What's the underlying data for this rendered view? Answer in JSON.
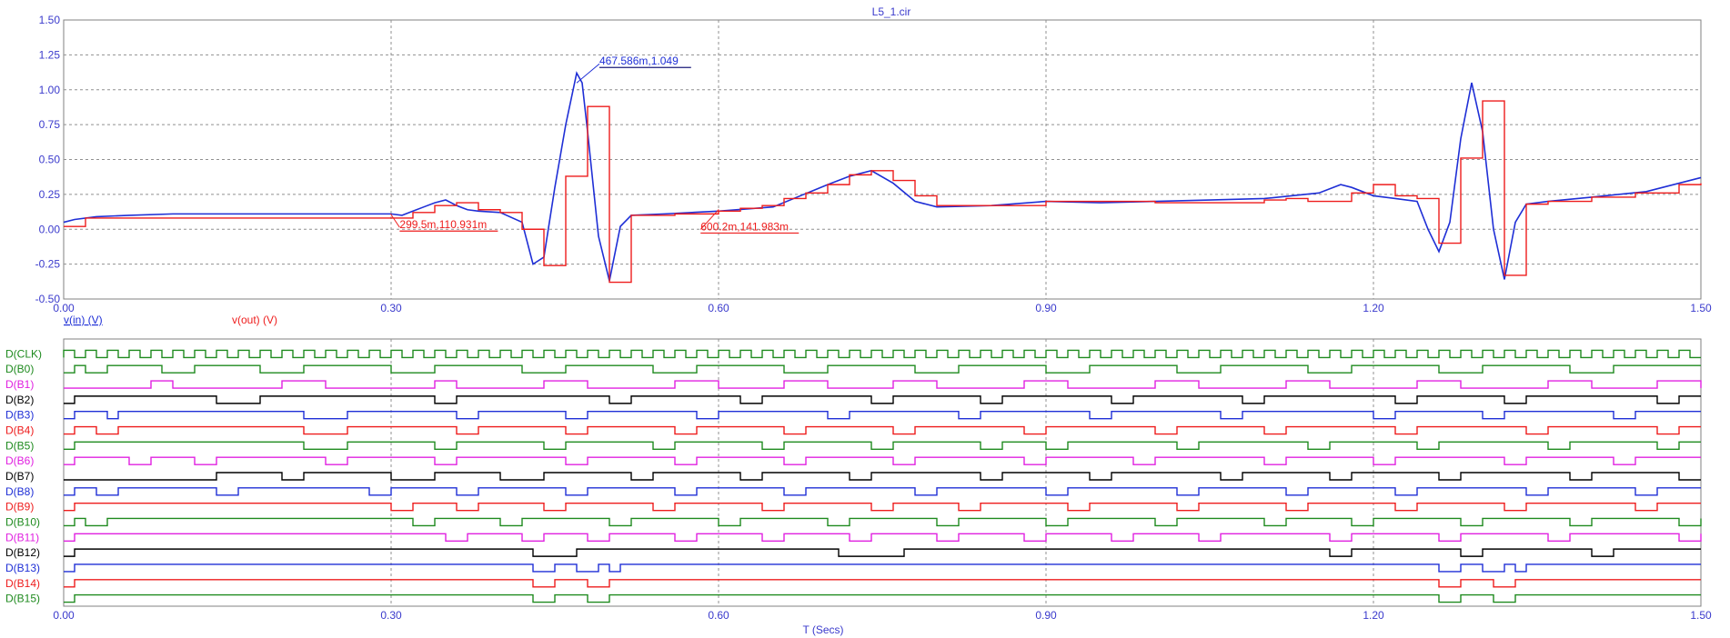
{
  "window_title": "L5_1.cir",
  "colors": {
    "background": "#ffffff",
    "frame": "#808080",
    "grid": "#909090",
    "tick_text": "#3a3acc",
    "vin": "#1f2fd6",
    "vout": "#ee1c1c",
    "green": "#1e8a1e",
    "magenta": "#e020e0",
    "black": "#000000",
    "blue": "#1f2fd6",
    "red": "#ee1c1c"
  },
  "chart_data": [
    {
      "type": "line",
      "title": "L5_1.cir",
      "x_range": [
        0,
        1.5
      ],
      "y_range": [
        -0.5,
        1.5
      ],
      "grid": true,
      "x_ticks": [
        "0.00",
        "0.30",
        "0.60",
        "0.90",
        "1.20",
        "1.50"
      ],
      "y_ticks": [
        "1.50",
        "1.25",
        "1.00",
        "0.75",
        "0.50",
        "0.25",
        "0.00",
        "-0.25",
        "-0.50"
      ],
      "legend": [
        {
          "name": "v(in) (V)",
          "color": "#1f2fd6"
        },
        {
          "name": "v(out) (V)",
          "color": "#ee1c1c"
        }
      ],
      "series": [
        {
          "name": "v(in) (V)",
          "style": "line",
          "color": "#1f2fd6",
          "x": [
            0.0,
            0.01,
            0.03,
            0.06,
            0.1,
            0.15,
            0.2,
            0.25,
            0.3,
            0.31,
            0.32,
            0.33,
            0.34,
            0.35,
            0.36,
            0.37,
            0.38,
            0.4,
            0.42,
            0.43,
            0.44,
            0.45,
            0.46,
            0.47,
            0.475,
            0.48,
            0.49,
            0.5,
            0.51,
            0.52,
            0.55,
            0.6,
            0.65,
            0.7,
            0.72,
            0.74,
            0.76,
            0.78,
            0.8,
            0.85,
            0.9,
            0.95,
            1.0,
            1.05,
            1.1,
            1.15,
            1.17,
            1.18,
            1.2,
            1.22,
            1.24,
            1.25,
            1.26,
            1.27,
            1.28,
            1.29,
            1.3,
            1.31,
            1.32,
            1.33,
            1.34,
            1.36,
            1.4,
            1.45,
            1.5
          ],
          "y": [
            0.05,
            0.07,
            0.09,
            0.1,
            0.11,
            0.11,
            0.11,
            0.11,
            0.11,
            0.1,
            0.13,
            0.16,
            0.19,
            0.21,
            0.17,
            0.14,
            0.13,
            0.12,
            0.05,
            -0.25,
            -0.2,
            0.3,
            0.75,
            1.12,
            1.05,
            0.7,
            -0.05,
            -0.37,
            0.02,
            0.1,
            0.11,
            0.13,
            0.16,
            0.32,
            0.38,
            0.42,
            0.33,
            0.2,
            0.16,
            0.17,
            0.2,
            0.19,
            0.2,
            0.21,
            0.22,
            0.26,
            0.32,
            0.3,
            0.24,
            0.22,
            0.2,
            0.0,
            -0.16,
            0.05,
            0.65,
            1.05,
            0.7,
            0.0,
            -0.36,
            0.05,
            0.18,
            0.2,
            0.23,
            0.27,
            0.37
          ]
        },
        {
          "name": "v(out) (V)",
          "style": "step",
          "color": "#ee1c1c",
          "x": [
            0.0,
            0.02,
            0.3,
            0.32,
            0.34,
            0.36,
            0.38,
            0.4,
            0.42,
            0.44,
            0.46,
            0.48,
            0.5,
            0.52,
            0.56,
            0.6,
            0.62,
            0.64,
            0.66,
            0.68,
            0.7,
            0.72,
            0.74,
            0.76,
            0.78,
            0.8,
            0.9,
            1.0,
            1.1,
            1.12,
            1.14,
            1.16,
            1.18,
            1.2,
            1.22,
            1.24,
            1.26,
            1.28,
            1.3,
            1.32,
            1.34,
            1.36,
            1.4,
            1.44,
            1.48,
            1.5
          ],
          "y": [
            0.02,
            0.08,
            0.08,
            0.12,
            0.17,
            0.19,
            0.14,
            0.12,
            0.0,
            -0.26,
            0.38,
            0.88,
            -0.38,
            0.1,
            0.11,
            0.13,
            0.15,
            0.17,
            0.22,
            0.26,
            0.32,
            0.39,
            0.42,
            0.35,
            0.24,
            0.17,
            0.2,
            0.19,
            0.21,
            0.22,
            0.2,
            0.2,
            0.26,
            0.32,
            0.24,
            0.22,
            -0.1,
            0.51,
            0.92,
            -0.33,
            0.18,
            0.2,
            0.23,
            0.26,
            0.32,
            0.33
          ]
        }
      ],
      "annotations": [
        {
          "text": "467.586m,1.049",
          "x": 0.47,
          "y": 1.049,
          "color": "#1f2fd6"
        },
        {
          "text": "299.5m,110.931m",
          "x": 0.2995,
          "y": 0.1109,
          "color": "#ee1c1c"
        },
        {
          "text": "600.2m,141.983m",
          "x": 0.6002,
          "y": 0.142,
          "color": "#ee1c1c"
        }
      ]
    },
    {
      "type": "digital",
      "x_range": [
        0,
        1.5
      ],
      "xlabel": "T (Secs)",
      "grid": true,
      "x_ticks": [
        "0.00",
        "0.30",
        "0.60",
        "0.90",
        "1.20",
        "1.50"
      ],
      "signals": [
        {
          "name": "D(CLK)",
          "color": "#1e8a1e",
          "clock_period": 0.02
        },
        {
          "name": "D(B0)",
          "color": "#1e8a1e",
          "transitions": [
            0.0,
            0.01,
            0.02,
            0.04,
            0.09,
            0.12,
            0.18,
            0.22,
            0.3,
            0.34,
            0.42,
            0.46,
            0.54,
            0.58,
            0.66,
            0.7,
            0.78,
            0.82,
            0.9,
            0.94,
            1.02,
            1.06,
            1.14,
            1.18,
            1.26,
            1.3,
            1.38,
            1.42
          ]
        },
        {
          "name": "D(B1)",
          "color": "#e020e0",
          "transitions": [
            0.0,
            0.08,
            0.1,
            0.2,
            0.24,
            0.34,
            0.36,
            0.44,
            0.48,
            0.56,
            0.6,
            0.66,
            0.7,
            0.76,
            0.8,
            0.88,
            0.92,
            1.0,
            1.04,
            1.12,
            1.16,
            1.24,
            1.28,
            1.36,
            1.4,
            1.46,
            1.5
          ]
        },
        {
          "name": "D(B2)",
          "color": "#000000",
          "transitions": [
            0.0,
            0.01,
            0.14,
            0.18,
            0.34,
            0.36,
            0.5,
            0.52,
            0.62,
            0.64,
            0.74,
            0.76,
            0.84,
            0.86,
            0.96,
            0.98,
            1.08,
            1.1,
            1.22,
            1.24,
            1.32,
            1.34,
            1.46,
            1.48
          ]
        },
        {
          "name": "D(B3)",
          "color": "#1f2fd6",
          "transitions": [
            0.0,
            0.01,
            0.04,
            0.05,
            0.22,
            0.26,
            0.36,
            0.38,
            0.46,
            0.48,
            0.58,
            0.6,
            0.7,
            0.72,
            0.82,
            0.84,
            0.94,
            0.96,
            1.06,
            1.08,
            1.2,
            1.22,
            1.3,
            1.32,
            1.42,
            1.44
          ]
        },
        {
          "name": "D(B4)",
          "color": "#ee1c1c",
          "transitions": [
            0.0,
            0.01,
            0.03,
            0.05,
            0.22,
            0.26,
            0.36,
            0.38,
            0.46,
            0.48,
            0.56,
            0.58,
            0.66,
            0.68,
            0.76,
            0.78,
            0.88,
            0.9,
            1.0,
            1.02,
            1.1,
            1.12,
            1.22,
            1.24,
            1.34,
            1.36,
            1.46,
            1.48
          ]
        },
        {
          "name": "D(B5)",
          "color": "#1e8a1e",
          "transitions": [
            0.0,
            0.01,
            0.22,
            0.26,
            0.34,
            0.36,
            0.44,
            0.46,
            0.54,
            0.56,
            0.64,
            0.66,
            0.74,
            0.76,
            0.84,
            0.86,
            0.9,
            0.92,
            1.02,
            1.04,
            1.14,
            1.16,
            1.24,
            1.26,
            1.36,
            1.38,
            1.46,
            1.48
          ]
        },
        {
          "name": "D(B6)",
          "color": "#e020e0",
          "transitions": [
            0.0,
            0.01,
            0.06,
            0.08,
            0.12,
            0.14,
            0.24,
            0.26,
            0.34,
            0.36,
            0.46,
            0.48,
            0.56,
            0.58,
            0.66,
            0.68,
            0.76,
            0.78,
            0.88,
            0.9,
            0.98,
            1.0,
            1.1,
            1.12,
            1.2,
            1.22,
            1.32,
            1.34,
            1.42,
            1.44
          ]
        },
        {
          "name": "D(B7)",
          "color": "#000000",
          "transitions": [
            0.0,
            0.14,
            0.2,
            0.22,
            0.3,
            0.34,
            0.4,
            0.44,
            0.52,
            0.54,
            0.62,
            0.64,
            0.72,
            0.74,
            0.84,
            0.86,
            0.94,
            0.96,
            1.06,
            1.08,
            1.16,
            1.18,
            1.26,
            1.28,
            1.38,
            1.4,
            1.48
          ]
        },
        {
          "name": "D(B8)",
          "color": "#1f2fd6",
          "transitions": [
            0.0,
            0.01,
            0.03,
            0.05,
            0.14,
            0.16,
            0.28,
            0.3,
            0.36,
            0.38,
            0.46,
            0.48,
            0.56,
            0.58,
            0.66,
            0.68,
            0.78,
            0.8,
            0.9,
            0.92,
            1.02,
            1.04,
            1.12,
            1.14,
            1.22,
            1.24,
            1.34,
            1.36,
            1.44,
            1.46
          ]
        },
        {
          "name": "D(B9)",
          "color": "#ee1c1c",
          "transitions": [
            0.0,
            0.01,
            0.3,
            0.32,
            0.36,
            0.38,
            0.44,
            0.46,
            0.54,
            0.56,
            0.64,
            0.66,
            0.74,
            0.76,
            0.82,
            0.84,
            0.92,
            0.94,
            1.02,
            1.04,
            1.12,
            1.14,
            1.22,
            1.24,
            1.32,
            1.34,
            1.44,
            1.46
          ]
        },
        {
          "name": "D(B10)",
          "color": "#1e8a1e",
          "transitions": [
            0.0,
            0.01,
            0.02,
            0.04,
            0.32,
            0.34,
            0.4,
            0.42,
            0.5,
            0.52,
            0.6,
            0.62,
            0.7,
            0.72,
            0.8,
            0.82,
            0.9,
            0.92,
            1.0,
            1.02,
            1.1,
            1.12,
            1.18,
            1.2,
            1.28,
            1.3,
            1.38,
            1.4,
            1.48,
            1.5
          ]
        },
        {
          "name": "D(B11)",
          "color": "#e020e0",
          "transitions": [
            0.0,
            0.01,
            0.35,
            0.37,
            0.42,
            0.44,
            0.48,
            0.5,
            0.56,
            0.58,
            0.64,
            0.66,
            0.72,
            0.74,
            0.8,
            0.82,
            0.88,
            0.9,
            0.96,
            0.98,
            1.04,
            1.06,
            1.16,
            1.18,
            1.26,
            1.28,
            1.36,
            1.38,
            1.48,
            1.5
          ]
        },
        {
          "name": "D(B12)",
          "color": "#000000",
          "transitions": [
            0.0,
            0.01,
            0.43,
            0.47,
            0.71,
            0.77,
            1.16,
            1.18,
            1.28,
            1.3,
            1.4,
            1.42
          ]
        },
        {
          "name": "D(B13)",
          "color": "#1f2fd6",
          "transitions": [
            0.0,
            0.01,
            0.43,
            0.45,
            0.47,
            0.49,
            0.5,
            0.51,
            1.26,
            1.28,
            1.3,
            1.32,
            1.33,
            1.34
          ]
        },
        {
          "name": "D(B14)",
          "color": "#ee1c1c",
          "transitions": [
            0.0,
            0.01,
            0.43,
            0.45,
            0.48,
            0.5,
            1.26,
            1.28,
            1.31,
            1.33
          ]
        },
        {
          "name": "D(B15)",
          "color": "#1e8a1e",
          "transitions": [
            0.0,
            0.01,
            0.43,
            0.45,
            0.48,
            0.5,
            1.26,
            1.28,
            1.31,
            1.33
          ]
        }
      ]
    }
  ]
}
